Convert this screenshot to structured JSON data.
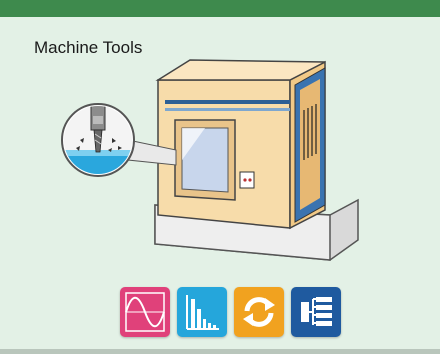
{
  "panel": {
    "title": "Machine Tools"
  },
  "colors": {
    "header_green": "#3e8a4d",
    "background": "#e3f1e6",
    "machine_body": "#f7dcaa",
    "machine_trim": "#2c5f95",
    "icon_waveform": "#e0417a",
    "icon_spectrum": "#25a6db",
    "icon_cycle": "#f1a21f",
    "icon_list": "#1f5a9f"
  },
  "icons": [
    {
      "name": "waveform-icon"
    },
    {
      "name": "spectrum-bars-icon"
    },
    {
      "name": "cycle-arrows-icon"
    },
    {
      "name": "list-tree-icon"
    }
  ]
}
